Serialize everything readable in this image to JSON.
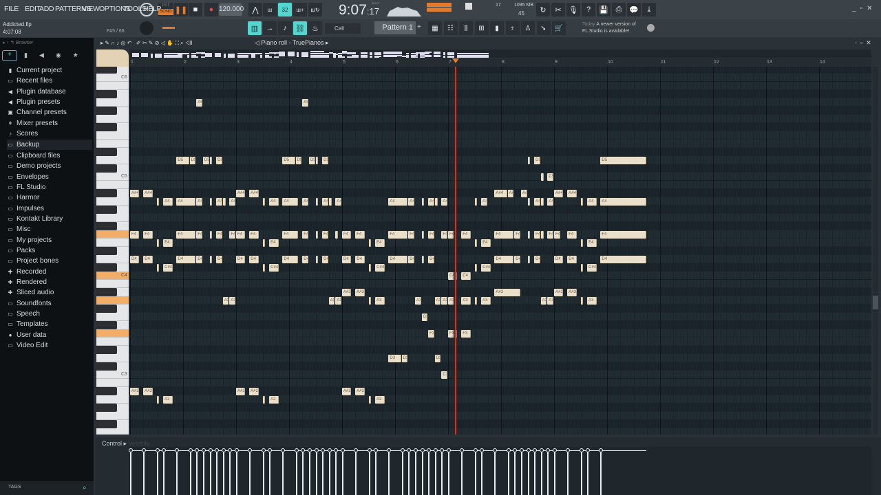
{
  "menu": [
    "FILE",
    "EDIT",
    "ADD",
    "PATTERNS",
    "VIEW",
    "OPTIONS",
    "TOOLS",
    "HELP"
  ],
  "transport": {
    "mode_pat": "PAT",
    "mode_song": "SONG",
    "tempo": "120.000",
    "time_main": "9:07",
    "time_sub": "17",
    "time_unit": "B:S:T"
  },
  "stats": {
    "cpu": "17",
    "memory": "1095 MB",
    "polyphony": "45"
  },
  "project": {
    "name": "Addicted.flp",
    "time": "4:07:08",
    "hint": "F#5 / 66"
  },
  "snap": {
    "label": "Cell"
  },
  "pattern": {
    "label": "Pattern 1",
    "add": "+"
  },
  "news": {
    "date": "Today",
    "line1": "A newer version of",
    "line2": "FL Studio is available!"
  },
  "browser": {
    "title": "Browser",
    "tags": "TAGS",
    "items": [
      {
        "label": "Current project",
        "icon": "file-icon"
      },
      {
        "label": "Recent files",
        "icon": "folder-recent-icon"
      },
      {
        "label": "Plugin database",
        "icon": "plug-icon"
      },
      {
        "label": "Plugin presets",
        "icon": "plug-icon"
      },
      {
        "label": "Channel presets",
        "icon": "channel-icon"
      },
      {
        "label": "Mixer presets",
        "icon": "mixer-icon"
      },
      {
        "label": "Scores",
        "icon": "note-icon"
      },
      {
        "label": "Backup",
        "icon": "folder-recent-icon"
      },
      {
        "label": "Clipboard files",
        "icon": "folder-icon"
      },
      {
        "label": "Demo projects",
        "icon": "folder-icon"
      },
      {
        "label": "Envelopes",
        "icon": "folder-icon"
      },
      {
        "label": "FL Studio",
        "icon": "folder-icon"
      },
      {
        "label": "Harmor",
        "icon": "folder-icon"
      },
      {
        "label": "Impulses",
        "icon": "folder-icon"
      },
      {
        "label": "Kontakt Library",
        "icon": "folder-icon"
      },
      {
        "label": "Misc",
        "icon": "folder-icon"
      },
      {
        "label": "My projects",
        "icon": "folder-icon"
      },
      {
        "label": "Packs",
        "icon": "folder-icon"
      },
      {
        "label": "Project bones",
        "icon": "folder-icon"
      },
      {
        "label": "Recorded",
        "icon": "record-folder-icon"
      },
      {
        "label": "Rendered",
        "icon": "record-folder-icon"
      },
      {
        "label": "Sliced audio",
        "icon": "record-folder-icon"
      },
      {
        "label": "Soundfonts",
        "icon": "folder-icon"
      },
      {
        "label": "Speech",
        "icon": "folder-icon"
      },
      {
        "label": "Templates",
        "icon": "folder-icon"
      },
      {
        "label": "User data",
        "icon": "user-icon"
      },
      {
        "label": "Video Edit",
        "icon": "folder-icon"
      }
    ]
  },
  "pianoroll": {
    "title": "Piano roll - TruePianos",
    "control_label": "Control",
    "control_target": "Velocity",
    "bars": [
      "1",
      "2",
      "3",
      "4",
      "5",
      "6",
      "7",
      "8",
      "9",
      "10",
      "11",
      "12",
      "13",
      "14"
    ],
    "key_labels": [
      "C6",
      "C5",
      "C4",
      "C3"
    ],
    "highlighted_keys": [
      "F4",
      "C4",
      "A3",
      "F3"
    ],
    "playhead_step": 98,
    "note_color": "#eadfcb",
    "playhead_color": "#c0392b",
    "accent": "#53d6d0"
  },
  "notes": [
    {
      "pitch": "A5",
      "events": [
        [
          20,
          2
        ],
        [
          52,
          2
        ]
      ]
    },
    {
      "pitch": "D5",
      "events": [
        [
          14,
          4
        ],
        [
          18,
          2
        ],
        [
          22,
          2
        ],
        [
          24,
          1
        ],
        [
          26,
          2
        ],
        [
          46,
          4
        ],
        [
          50,
          2
        ],
        [
          54,
          2
        ],
        [
          56,
          1
        ],
        [
          58,
          2
        ],
        [
          120,
          1
        ],
        [
          122,
          2
        ],
        [
          142,
          14
        ]
      ]
    },
    {
      "pitch": "C5",
      "events": [
        [
          124,
          1
        ],
        [
          126,
          2
        ]
      ]
    },
    {
      "pitch": "A#4",
      "events": [
        [
          0,
          3
        ],
        [
          4,
          3
        ],
        [
          32,
          3
        ],
        [
          36,
          3
        ],
        [
          110,
          4
        ],
        [
          114,
          2
        ],
        [
          118,
          2
        ],
        [
          128,
          3
        ],
        [
          132,
          3
        ]
      ]
    },
    {
      "pitch": "A4",
      "events": [
        [
          8,
          1
        ],
        [
          10,
          3
        ],
        [
          14,
          6
        ],
        [
          20,
          2
        ],
        [
          24,
          1
        ],
        [
          26,
          2
        ],
        [
          28,
          1
        ],
        [
          30,
          2
        ],
        [
          40,
          1
        ],
        [
          42,
          3
        ],
        [
          46,
          5
        ],
        [
          52,
          2
        ],
        [
          56,
          1
        ],
        [
          58,
          2
        ],
        [
          60,
          1
        ],
        [
          62,
          2
        ],
        [
          78,
          6
        ],
        [
          84,
          2
        ],
        [
          88,
          1
        ],
        [
          90,
          2
        ],
        [
          92,
          1
        ],
        [
          94,
          2
        ],
        [
          104,
          1
        ],
        [
          106,
          2
        ],
        [
          120,
          1
        ],
        [
          122,
          2
        ],
        [
          124,
          1
        ],
        [
          126,
          2
        ],
        [
          136,
          1
        ],
        [
          138,
          3
        ],
        [
          142,
          14
        ]
      ]
    },
    {
      "pitch": "F4",
      "events": [
        [
          0,
          3
        ],
        [
          4,
          3
        ],
        [
          14,
          6
        ],
        [
          20,
          2
        ],
        [
          24,
          1
        ],
        [
          26,
          2
        ],
        [
          30,
          2
        ],
        [
          32,
          3
        ],
        [
          36,
          3
        ],
        [
          46,
          5
        ],
        [
          52,
          2
        ],
        [
          56,
          1
        ],
        [
          58,
          2
        ],
        [
          62,
          1
        ],
        [
          64,
          3
        ],
        [
          68,
          3
        ],
        [
          78,
          6
        ],
        [
          84,
          2
        ],
        [
          88,
          1
        ],
        [
          90,
          2
        ],
        [
          94,
          2
        ],
        [
          96,
          2
        ],
        [
          100,
          3
        ],
        [
          110,
          6
        ],
        [
          116,
          2
        ],
        [
          120,
          1
        ],
        [
          122,
          2
        ],
        [
          124,
          1
        ],
        [
          126,
          2
        ],
        [
          128,
          2
        ],
        [
          132,
          3
        ],
        [
          142,
          14
        ]
      ]
    },
    {
      "pitch": "E4",
      "events": [
        [
          8,
          1
        ],
        [
          10,
          3
        ],
        [
          40,
          1
        ],
        [
          42,
          3
        ],
        [
          72,
          1
        ],
        [
          74,
          3
        ],
        [
          104,
          1
        ],
        [
          106,
          3
        ],
        [
          136,
          1
        ],
        [
          138,
          3
        ]
      ]
    },
    {
      "pitch": "D4",
      "events": [
        [
          0,
          3
        ],
        [
          4,
          3
        ],
        [
          14,
          6
        ],
        [
          20,
          2
        ],
        [
          24,
          1
        ],
        [
          26,
          2
        ],
        [
          32,
          3
        ],
        [
          36,
          3
        ],
        [
          46,
          5
        ],
        [
          52,
          2
        ],
        [
          56,
          1
        ],
        [
          58,
          2
        ],
        [
          64,
          3
        ],
        [
          68,
          3
        ],
        [
          78,
          6
        ],
        [
          84,
          2
        ],
        [
          88,
          1
        ],
        [
          90,
          2
        ],
        [
          110,
          6
        ],
        [
          116,
          2
        ],
        [
          120,
          1
        ],
        [
          122,
          2
        ],
        [
          128,
          3
        ],
        [
          132,
          3
        ],
        [
          142,
          14
        ]
      ]
    },
    {
      "pitch": "C#4",
      "events": [
        [
          8,
          1
        ],
        [
          10,
          3
        ],
        [
          40,
          1
        ],
        [
          42,
          3
        ],
        [
          72,
          1
        ],
        [
          74,
          3
        ],
        [
          104,
          1
        ],
        [
          106,
          3
        ],
        [
          136,
          1
        ],
        [
          138,
          3
        ]
      ]
    },
    {
      "pitch": "C4",
      "events": [
        [
          96,
          3
        ],
        [
          100,
          3
        ]
      ]
    },
    {
      "pitch": "A#3",
      "events": [
        [
          64,
          3
        ],
        [
          68,
          3
        ],
        [
          110,
          8
        ],
        [
          128,
          3
        ],
        [
          132,
          3
        ]
      ]
    },
    {
      "pitch": "A3",
      "events": [
        [
          28,
          2
        ],
        [
          30,
          2
        ],
        [
          60,
          2
        ],
        [
          62,
          2
        ],
        [
          72,
          1
        ],
        [
          74,
          3
        ],
        [
          86,
          2
        ],
        [
          92,
          2
        ],
        [
          94,
          2
        ],
        [
          96,
          2
        ],
        [
          100,
          3
        ],
        [
          104,
          1
        ],
        [
          106,
          3
        ],
        [
          124,
          2
        ],
        [
          126,
          2
        ],
        [
          136,
          1
        ],
        [
          138,
          3
        ]
      ]
    },
    {
      "pitch": "G3",
      "events": [
        [
          88,
          2
        ]
      ]
    },
    {
      "pitch": "F3",
      "events": [
        [
          90,
          2
        ],
        [
          96,
          3
        ],
        [
          100,
          3
        ]
      ]
    },
    {
      "pitch": "D3",
      "events": [
        [
          78,
          4
        ],
        [
          82,
          2
        ],
        [
          92,
          2
        ]
      ]
    },
    {
      "pitch": "C3",
      "events": [
        [
          94,
          2
        ]
      ]
    },
    {
      "pitch": "A#2",
      "events": [
        [
          0,
          3
        ],
        [
          4,
          3
        ],
        [
          32,
          3
        ],
        [
          36,
          3
        ],
        [
          64,
          3
        ],
        [
          68,
          3
        ]
      ]
    },
    {
      "pitch": "A2",
      "events": [
        [
          8,
          1
        ],
        [
          10,
          3
        ],
        [
          40,
          1
        ],
        [
          42,
          3
        ],
        [
          72,
          1
        ],
        [
          74,
          3
        ]
      ]
    }
  ]
}
